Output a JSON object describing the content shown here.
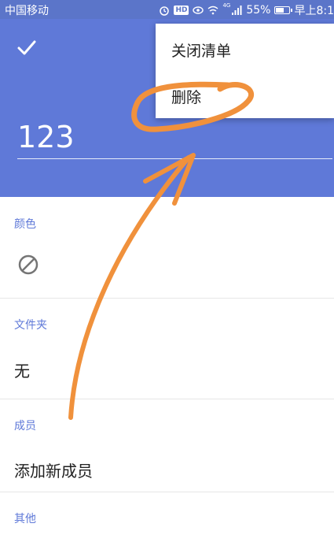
{
  "status_bar": {
    "carrier": "中国移动",
    "network": "4G",
    "battery_percent": "55%",
    "time": "早上8:1",
    "battery_level": 0.55
  },
  "header": {
    "confirm_icon": "check-icon",
    "title_value": "123",
    "background_color": "#5f79d8"
  },
  "menu": {
    "items": [
      {
        "label": "关闭清单"
      },
      {
        "label": "删除"
      }
    ]
  },
  "sections": {
    "color": {
      "label": "颜色",
      "icon": "no-color-icon"
    },
    "folder": {
      "label": "文件夹",
      "value": "无"
    },
    "members": {
      "label": "成员",
      "value": "添加新成员"
    },
    "other": {
      "label": "其他"
    }
  },
  "annotation_color": "#f0913c"
}
